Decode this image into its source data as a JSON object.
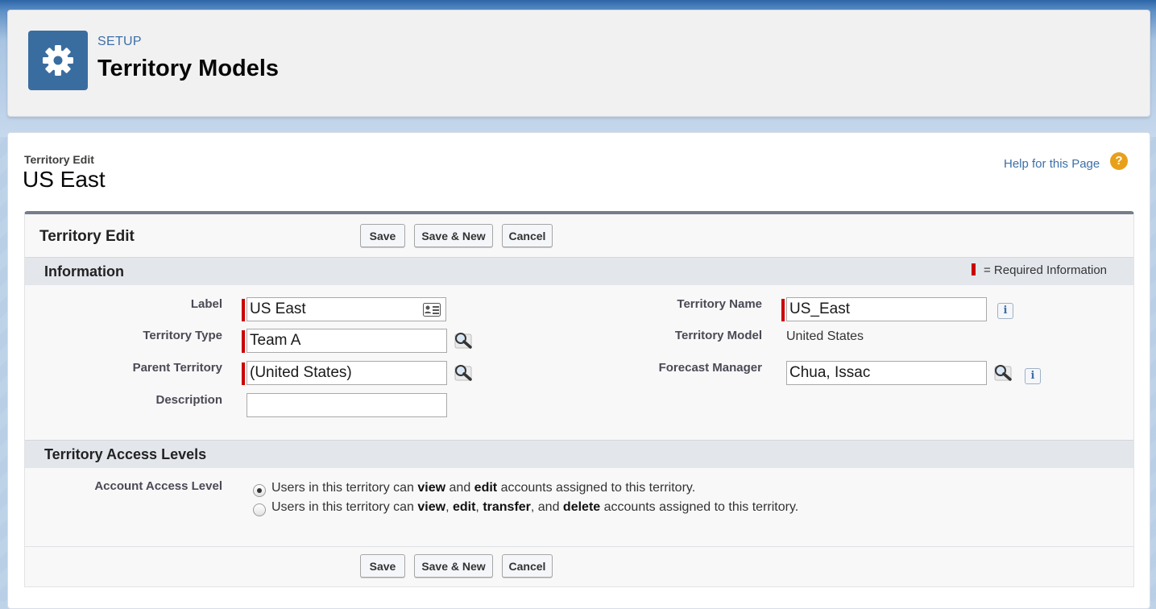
{
  "header": {
    "setup_label": "SETUP",
    "title": "Territory Models",
    "icon": "gear-icon"
  },
  "record": {
    "breadcrumb": "Territory Edit",
    "title": "US East",
    "help_link": "Help for this Page",
    "help_icon": "?"
  },
  "edit_block": {
    "title": "Territory Edit",
    "buttons": {
      "save": "Save",
      "save_new": "Save & New",
      "cancel": "Cancel"
    }
  },
  "information": {
    "title": "Information",
    "required_legend": "= Required Information",
    "fields": {
      "label": {
        "label": "Label",
        "value": "US East"
      },
      "territory_type": {
        "label": "Territory Type",
        "value": "Team A"
      },
      "parent_territory": {
        "label": "Parent Territory",
        "value": "(United States)"
      },
      "description": {
        "label": "Description",
        "value": ""
      },
      "territory_name": {
        "label": "Territory Name",
        "value": "US_East"
      },
      "territory_model": {
        "label": "Territory Model",
        "value": "United States"
      },
      "forecast_manager": {
        "label": "Forecast Manager",
        "value": "Chua, Issac"
      }
    },
    "info_glyph": "i"
  },
  "access_levels": {
    "title": "Territory Access Levels",
    "field_label": "Account Access Level",
    "options": [
      {
        "selected": true,
        "p1": "Users in this territory can ",
        "b1": "view",
        "p2": " and ",
        "b2": "edit",
        "p3": " accounts assigned to this territory."
      },
      {
        "selected": false,
        "p1": "Users in this territory can ",
        "b1": "view",
        "p2": ", ",
        "b2": "edit",
        "p3": ", ",
        "b3": "transfer",
        "p4": ", and ",
        "b4": "delete",
        "p5": " accounts assigned to this territory."
      }
    ]
  }
}
